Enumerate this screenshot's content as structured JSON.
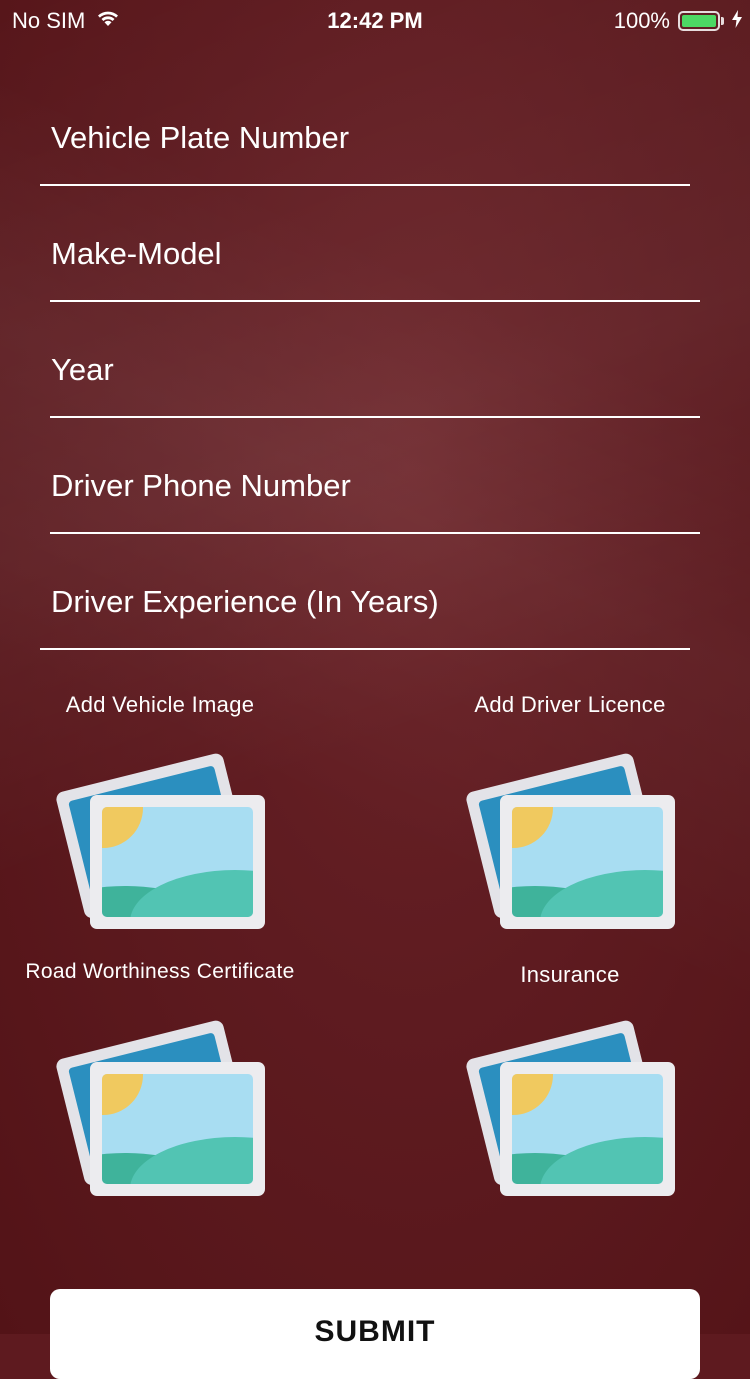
{
  "status_bar": {
    "carrier": "No SIM",
    "wifi_icon": "wifi-icon",
    "time": "12:42 PM",
    "battery_percent": "100%",
    "battery_level": 1.0,
    "battery_color": "#4cd964",
    "charging_icon": "bolt-icon"
  },
  "form": {
    "fields": [
      {
        "placeholder": "Vehicle Plate Number",
        "value": ""
      },
      {
        "placeholder": "Make-Model",
        "value": ""
      },
      {
        "placeholder": "Year",
        "value": ""
      },
      {
        "placeholder": "Driver Phone Number",
        "value": ""
      },
      {
        "placeholder": "Driver Experience (In Years)",
        "value": ""
      }
    ]
  },
  "uploads": [
    {
      "label": "Add Vehicle Image",
      "icon": "image-placeholder-icon"
    },
    {
      "label": "Add Driver Licence",
      "icon": "image-placeholder-icon"
    },
    {
      "label": "Road Worthiness Certificate",
      "icon": "image-placeholder-icon"
    },
    {
      "label": "Insurance",
      "icon": "image-placeholder-icon"
    }
  ],
  "submit": {
    "label": "SUBMIT"
  },
  "colors": {
    "background": "#5e1a1f",
    "button": "#ffffff",
    "photo_frame": "#ececef",
    "photo_back": "#2b8fbf",
    "photo_sky": "#a8ddf2",
    "sun": "#f0c95f",
    "hill_dark": "#3fb39b",
    "hill_light": "#52c4b3"
  }
}
